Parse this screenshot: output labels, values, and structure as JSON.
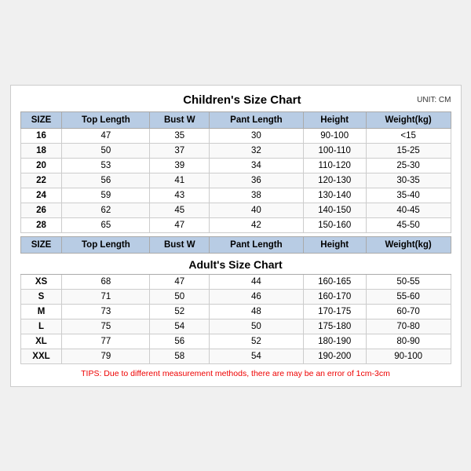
{
  "chart": {
    "title": "Children's Size Chart",
    "adult_title": "Adult's Size Chart",
    "unit": "UNIT: CM",
    "columns": [
      "SIZE",
      "Top Length",
      "Bust W",
      "Pant Length",
      "Height",
      "Weight(kg)"
    ],
    "children_rows": [
      [
        "16",
        "47",
        "35",
        "30",
        "90-100",
        "<15"
      ],
      [
        "18",
        "50",
        "37",
        "32",
        "100-110",
        "15-25"
      ],
      [
        "20",
        "53",
        "39",
        "34",
        "110-120",
        "25-30"
      ],
      [
        "22",
        "56",
        "41",
        "36",
        "120-130",
        "30-35"
      ],
      [
        "24",
        "59",
        "43",
        "38",
        "130-140",
        "35-40"
      ],
      [
        "26",
        "62",
        "45",
        "40",
        "140-150",
        "40-45"
      ],
      [
        "28",
        "65",
        "47",
        "42",
        "150-160",
        "45-50"
      ]
    ],
    "adult_rows": [
      [
        "XS",
        "68",
        "47",
        "44",
        "160-165",
        "50-55"
      ],
      [
        "S",
        "71",
        "50",
        "46",
        "160-170",
        "55-60"
      ],
      [
        "M",
        "73",
        "52",
        "48",
        "170-175",
        "60-70"
      ],
      [
        "L",
        "75",
        "54",
        "50",
        "175-180",
        "70-80"
      ],
      [
        "XL",
        "77",
        "56",
        "52",
        "180-190",
        "80-90"
      ],
      [
        "XXL",
        "79",
        "58",
        "54",
        "190-200",
        "90-100"
      ]
    ],
    "tips": "TIPS: Due to different measurement methods, there are may be an error of 1cm-3cm"
  }
}
